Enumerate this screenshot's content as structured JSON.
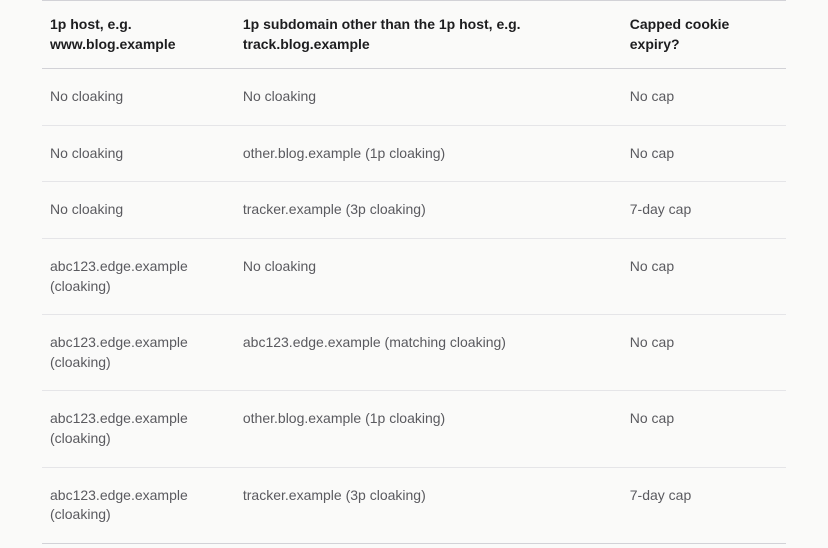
{
  "table": {
    "headers": {
      "col1": "1p host, e.g. www.blog.example",
      "col2": "1p subdomain other than the 1p host, e.g. track.blog.example",
      "col3": "Capped cookie expiry?"
    },
    "rows": [
      {
        "col1": "No cloaking",
        "col2": "No cloaking",
        "col3": "No cap"
      },
      {
        "col1": "No cloaking",
        "col2": "other.blog.example (1p cloaking)",
        "col3": "No cap"
      },
      {
        "col1": "No cloaking",
        "col2": "tracker.example (3p cloaking)",
        "col3": "7-day cap"
      },
      {
        "col1": "abc123.edge.example (cloaking)",
        "col2": "No cloaking",
        "col3": "No cap"
      },
      {
        "col1": "abc123.edge.example (cloaking)",
        "col2": "abc123.edge.example (matching cloaking)",
        "col3": "No cap"
      },
      {
        "col1": "abc123.edge.example (cloaking)",
        "col2": "other.blog.example (1p cloaking)",
        "col3": "No cap"
      },
      {
        "col1": "abc123.edge.example (cloaking)",
        "col2": "tracker.example (3p cloaking)",
        "col3": "7-day cap"
      }
    ]
  }
}
